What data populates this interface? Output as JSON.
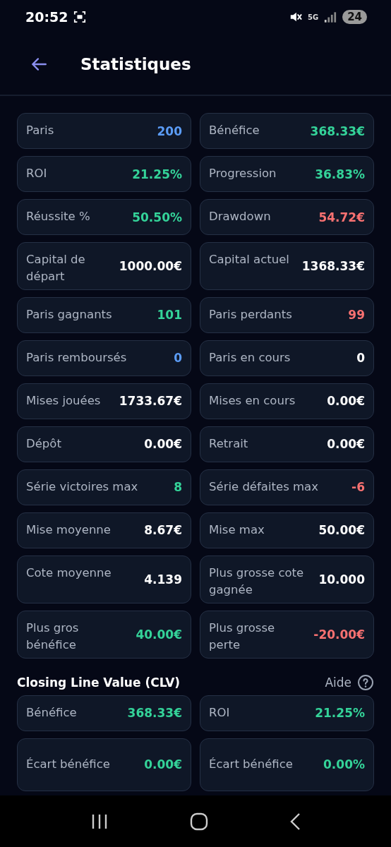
{
  "status_bar": {
    "time": "20:52",
    "network": "5G",
    "battery": "24"
  },
  "header": {
    "title": "Statistiques"
  },
  "stats": [
    {
      "label": "Paris",
      "value": "200",
      "color": "#5b9cf6"
    },
    {
      "label": "Bénéfice",
      "value": "368.33€",
      "color": "#34d399"
    },
    {
      "label": "ROI",
      "value": "21.25%",
      "color": "#34d399"
    },
    {
      "label": "Progression",
      "value": "36.83%",
      "color": "#34d399"
    },
    {
      "label": "Réussite %",
      "value": "50.50%",
      "color": "#34d399"
    },
    {
      "label": "Drawdown",
      "value": "54.72€",
      "color": "#f87171"
    },
    {
      "label": "Capital de départ",
      "value": "1000.00€",
      "color": "#ffffff"
    },
    {
      "label": "Capital actuel",
      "value": "1368.33€",
      "color": "#ffffff"
    },
    {
      "label": "Paris gagnants",
      "value": "101",
      "color": "#34d399"
    },
    {
      "label": "Paris perdants",
      "value": "99",
      "color": "#f87171"
    },
    {
      "label": "Paris remboursés",
      "value": "0",
      "color": "#5b9cf6"
    },
    {
      "label": "Paris en cours",
      "value": "0",
      "color": "#ffffff"
    },
    {
      "label": "Mises jouées",
      "value": "1733.67€",
      "color": "#ffffff"
    },
    {
      "label": "Mises en cours",
      "value": "0.00€",
      "color": "#ffffff"
    },
    {
      "label": "Dépôt",
      "value": "0.00€",
      "color": "#ffffff"
    },
    {
      "label": "Retrait",
      "value": "0.00€",
      "color": "#ffffff"
    },
    {
      "label": "Série victoires max",
      "value": "8",
      "color": "#34d399"
    },
    {
      "label": "Série défaites max",
      "value": "-6",
      "color": "#f87171"
    },
    {
      "label": "Mise moyenne",
      "value": "8.67€",
      "color": "#ffffff"
    },
    {
      "label": "Mise max",
      "value": "50.00€",
      "color": "#ffffff"
    },
    {
      "label": "Cote moyenne",
      "value": "4.139",
      "color": "#ffffff"
    },
    {
      "label": "Plus grosse cote gagnée",
      "value": "10.000",
      "color": "#ffffff"
    },
    {
      "label": "Plus gros bénéfice",
      "value": "40.00€",
      "color": "#34d399"
    },
    {
      "label": "Plus grosse perte",
      "value": "-20.00€",
      "color": "#f87171"
    }
  ],
  "clv": {
    "title": "Closing Line Value (CLV)",
    "help": "Aide",
    "stats": [
      {
        "label": "Bénéfice",
        "value": "368.33€",
        "color": "#34d399"
      },
      {
        "label": "ROI",
        "value": "21.25%",
        "color": "#34d399"
      },
      {
        "label": "Écart bénéfice",
        "value": "0.00€",
        "color": "#34d399"
      },
      {
        "label": "Écart bénéfice",
        "value": "0.00%",
        "color": "#34d399"
      }
    ]
  }
}
